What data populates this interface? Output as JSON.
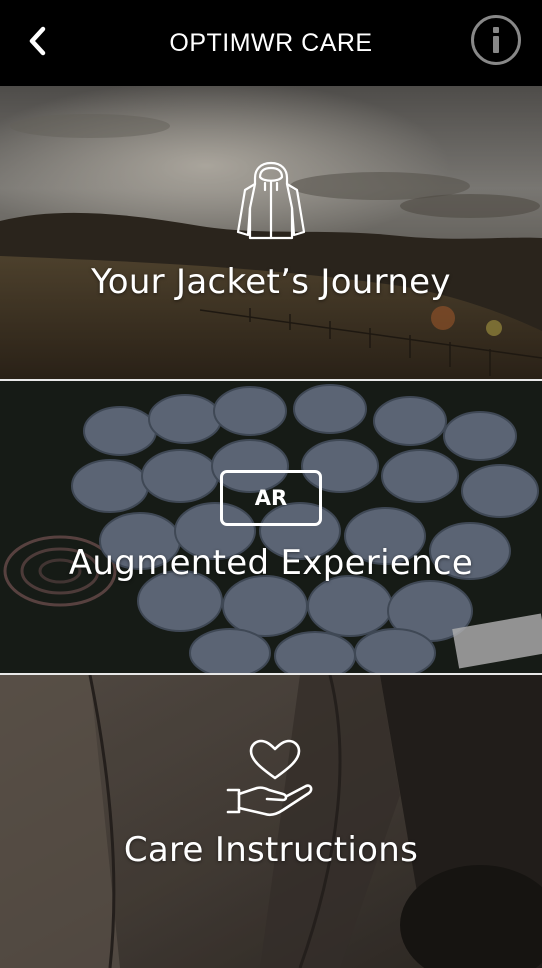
{
  "header": {
    "title": "OPTIMWR CARE",
    "back_icon": "chevron-left-icon",
    "info_icon": "info-icon"
  },
  "cards": [
    {
      "label": "Your Jacket’s Journey",
      "icon": "jacket-icon"
    },
    {
      "label": "Augmented Experience",
      "icon": "ar-icon",
      "badge": "AR"
    },
    {
      "label": "Care Instructions",
      "icon": "heart-hand-icon"
    }
  ],
  "colors": {
    "header_bg": "#000000",
    "text": "#ffffff",
    "divider": "#e8e8e8"
  }
}
